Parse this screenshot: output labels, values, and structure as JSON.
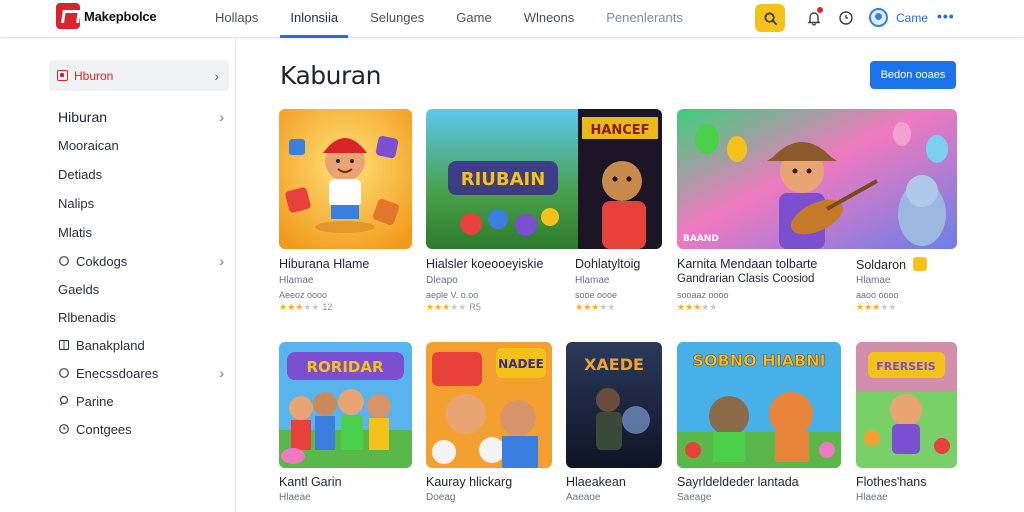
{
  "app": {
    "logo_text": "Makepbolce"
  },
  "nav": [
    {
      "label": "Hollaps"
    },
    {
      "label": "Inlonsiia"
    },
    {
      "label": "Selunges"
    },
    {
      "label": "Game"
    },
    {
      "label": "Wlneons"
    },
    {
      "label": "Penenlerants"
    }
  ],
  "header": {
    "user_name": "Came",
    "more": "•••"
  },
  "sidebar": {
    "active": {
      "label": "Hburon",
      "chevron": "›"
    },
    "items": [
      {
        "label": "Hiburan",
        "chevron": "›",
        "icon": ""
      },
      {
        "label": "Mooraican",
        "chevron": "",
        "icon": ""
      },
      {
        "label": "Detiads",
        "chevron": "",
        "icon": ""
      },
      {
        "label": "Nalips",
        "chevron": "",
        "icon": ""
      },
      {
        "label": "Mlatis",
        "chevron": "",
        "icon": ""
      },
      {
        "label": "Cokdogs",
        "chevron": "›",
        "icon": "circle-icon"
      },
      {
        "label": "Gaelds",
        "chevron": "",
        "icon": ""
      },
      {
        "label": "Rlbenadis",
        "chevron": "",
        "icon": ""
      },
      {
        "label": "Banakpland",
        "chevron": "",
        "icon": "grid-icon"
      },
      {
        "label": "Enecssdoares",
        "chevron": "›",
        "icon": "circle-icon"
      },
      {
        "label": "Parine",
        "chevron": "",
        "icon": "pin-icon"
      },
      {
        "label": "Contgees",
        "chevron": "",
        "icon": "clock-icon"
      }
    ]
  },
  "main": {
    "title": "Kaburan",
    "button_label": "Bedon ooaes",
    "cards_row1": [
      {
        "title": "Hiburana Hlame",
        "sub": "Hlamae",
        "meta": "Aeeoz oooo",
        "rating": 3,
        "count": "12",
        "thumb_label": ""
      },
      {
        "title": "Hialsler koeooeyiskie",
        "sub": "Dleapo",
        "meta": "aeple V. o.oo",
        "rating": 3,
        "count": "R5",
        "thumb_label": "RIUBAIN"
      },
      {
        "title": "Dohlatyltoig",
        "sub": "Hlamae",
        "meta": "sooe oooe",
        "rating": 3,
        "count": "",
        "thumb_label": "HANCEF"
      },
      {
        "title": "Karnita Mendaan tolbarte",
        "sub": "Gandrarian Clasis Coosiod",
        "meta": "sooaaz oooo",
        "rating": 3,
        "count": "",
        "thumb_label": "BAAND"
      },
      {
        "title": "Soldaron",
        "sub": "Hlamae",
        "meta": "aaoo oooo",
        "rating": 3,
        "count": "",
        "thumb_label": ""
      }
    ],
    "cards_row2": [
      {
        "title": "Kantl Garin",
        "sub": "Hlaeae",
        "meta": "",
        "thumb_label": "RORIDAR"
      },
      {
        "title": "Kauray hlickarg",
        "sub": "Doeag",
        "meta": "",
        "thumb_label": "NADEE"
      },
      {
        "title": "Hlaeakean",
        "sub": "Aaeaoe",
        "meta": "",
        "thumb_label": "XAEDE"
      },
      {
        "title": "Sayrldeldeder lantada",
        "sub": "Saeage",
        "meta": "",
        "thumb_label": "SOBNO HIABNI"
      },
      {
        "title": "Flothes'hans",
        "sub": "Hlaeae",
        "meta": "",
        "thumb_label": "FRERSEIS"
      }
    ]
  },
  "colors": {
    "accent": "#1a73e8",
    "brand": "#d8242b",
    "search": "#f4c21a",
    "star": "#f2b01e"
  }
}
